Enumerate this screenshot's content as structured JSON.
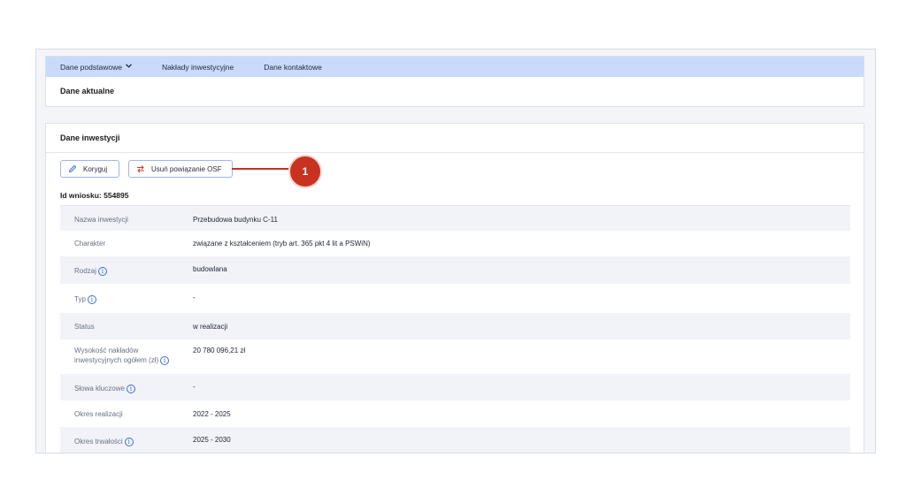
{
  "nav": {
    "items": [
      {
        "label": "Dane podstawowe"
      },
      {
        "label": "Nakłady inwestycyjne"
      },
      {
        "label": "Dane kontaktowe"
      }
    ]
  },
  "current": {
    "title": "Dane aktualne"
  },
  "investment": {
    "title": "Dane inwestycji",
    "edit_label": "Koryguj",
    "unlink_label": "Usuń powiązanie OSF",
    "callout_number": "1",
    "id_line": "Id wniosku: 554895",
    "rows": [
      {
        "label": "Nazwa inwestycji",
        "value": "Przebudowa budynku C-11"
      },
      {
        "label": "Charakter",
        "value": "związane z kształceniem (tryb art. 365 pkt 4 lit a PSWiN)"
      },
      {
        "label": "Rodzaj",
        "value": "budowlana"
      },
      {
        "label": "Typ",
        "value": "-"
      },
      {
        "label": "Status",
        "value": "w realizacji"
      },
      {
        "label": "Wysokość nakładów",
        "label2": "inwestycyjnych ogółem (zł)",
        "value": "20 780 096,21 zł"
      },
      {
        "label": "Słowa kluczowe",
        "value": "-"
      },
      {
        "label": "Okres realizacji",
        "value": "2022 - 2025"
      },
      {
        "label": "Okres trwałości",
        "value": "2025 - 2030"
      }
    ]
  },
  "colors": {
    "accent": "#3b6fd8",
    "nav_bg": "#c9dafa",
    "callout": "#c9321f",
    "unlink_icon": "#d23a2a"
  },
  "icons": {
    "edit": "pencil-icon",
    "unlink": "unlink-arrows-icon",
    "info": "info-icon",
    "dropdown": "chevron-down-icon"
  }
}
